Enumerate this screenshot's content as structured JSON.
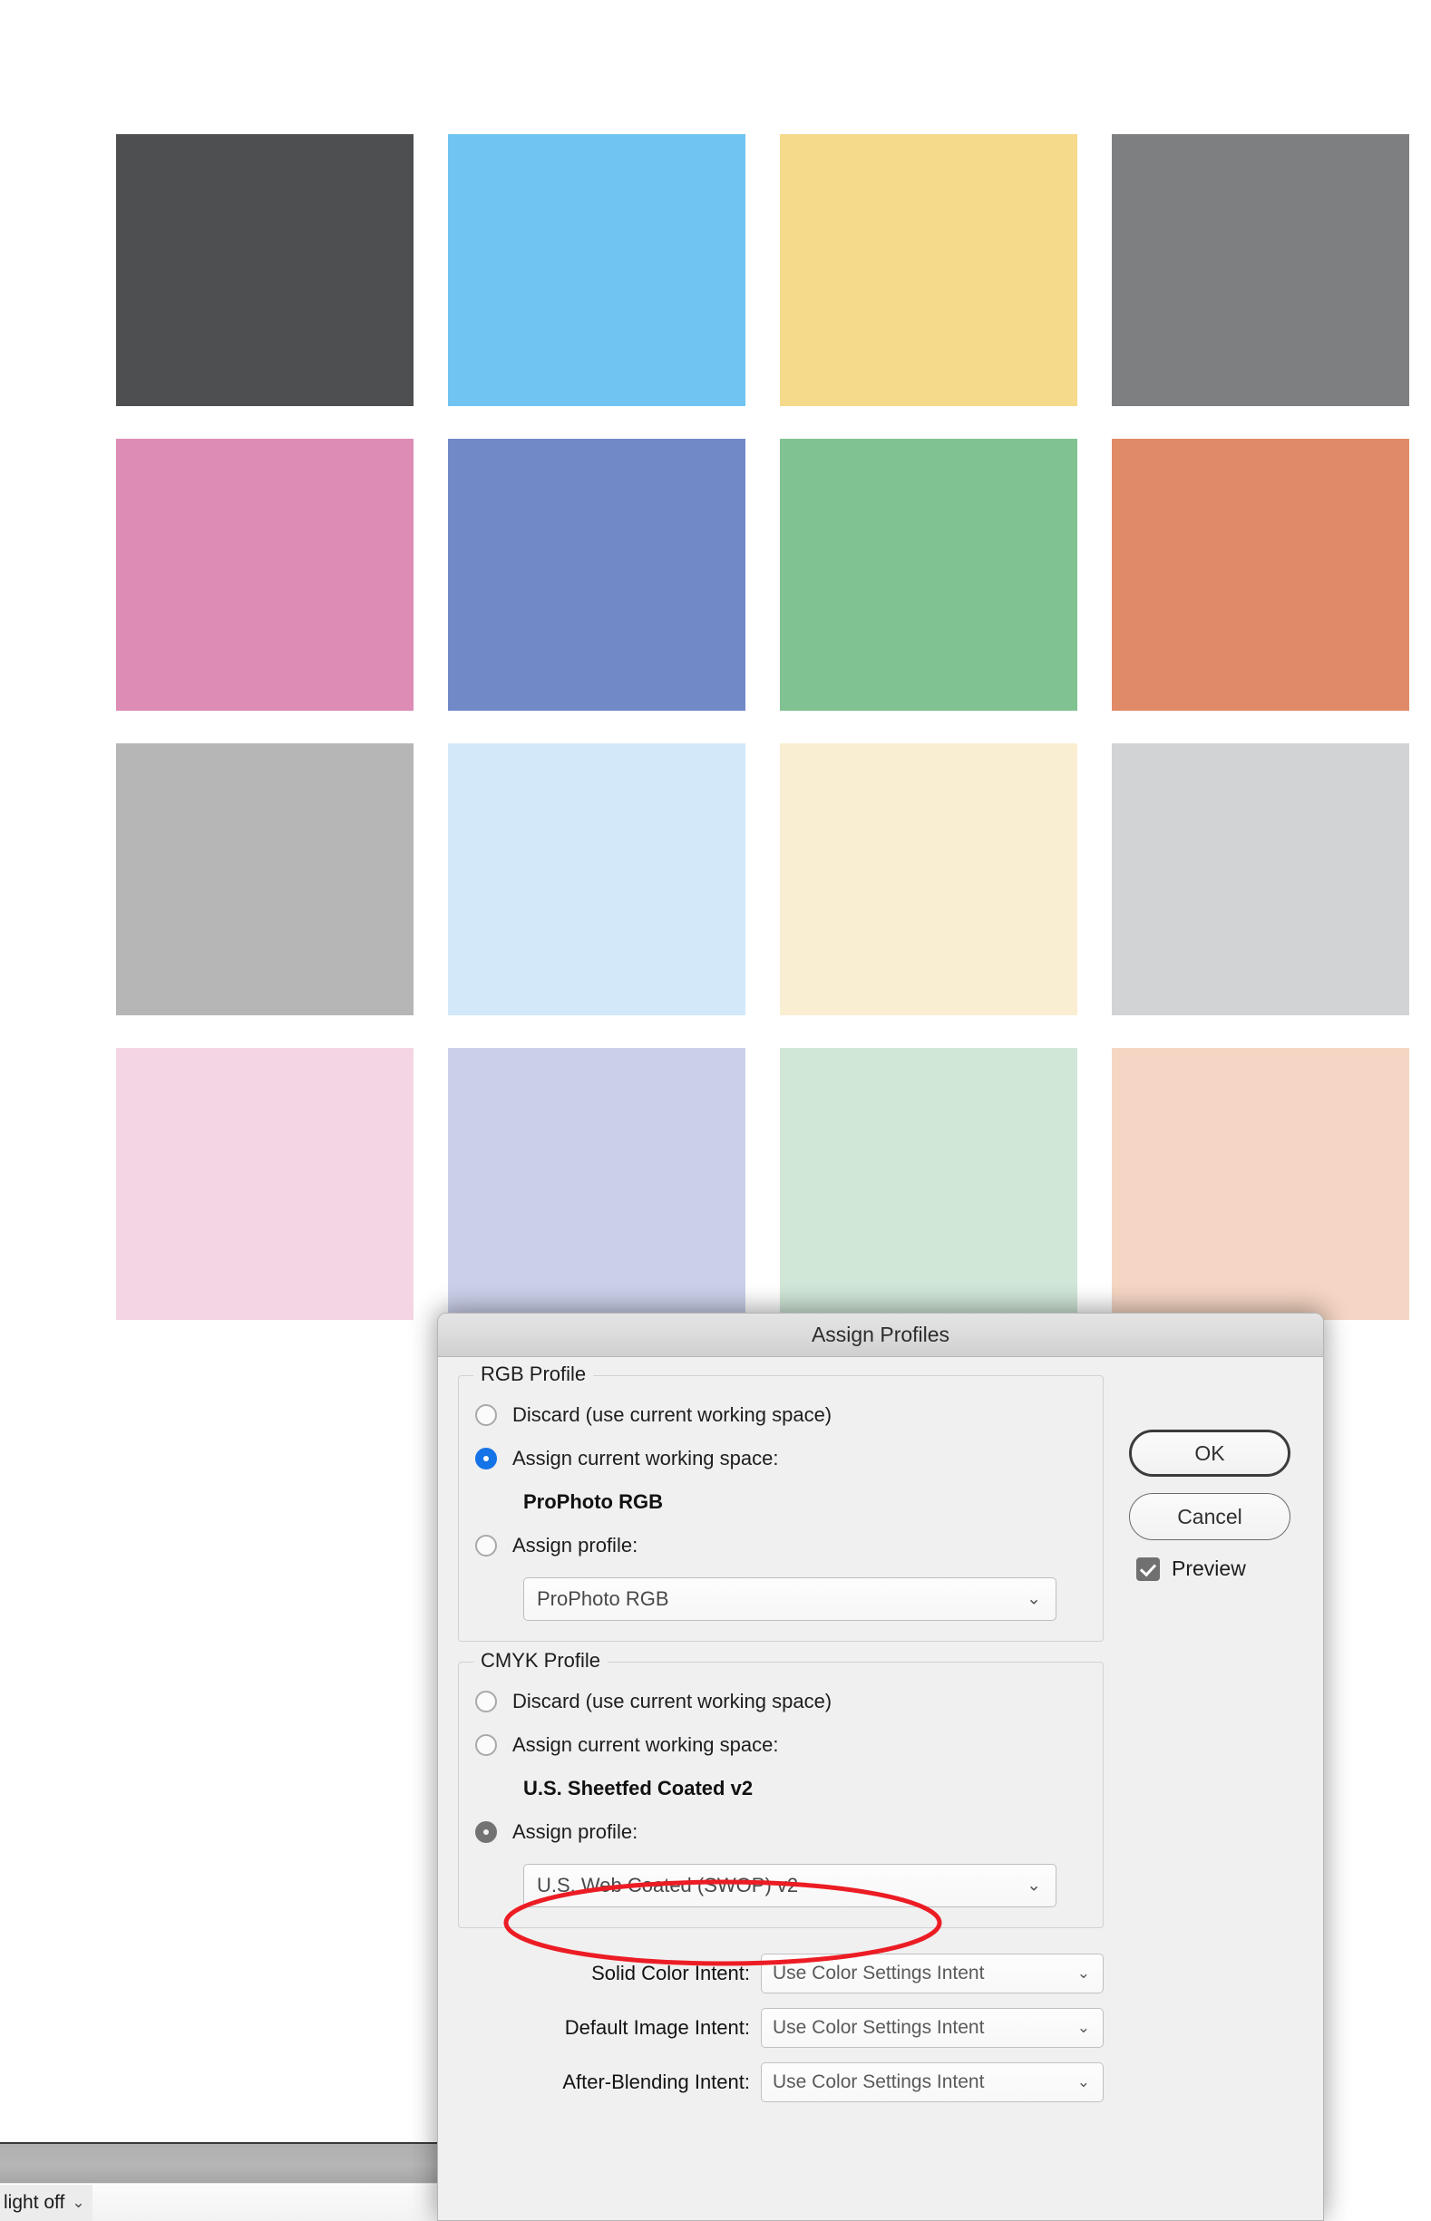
{
  "swatches": {
    "rows": [
      [
        {
          "name": "swatch-dark-gray",
          "color": "#4e4f50"
        },
        {
          "name": "swatch-sky-blue",
          "color": "#6fc4f2"
        },
        {
          "name": "swatch-yellow",
          "color": "#f5da8c"
        },
        {
          "name": "swatch-mid-gray",
          "color": "#7e7f81"
        }
      ],
      [
        {
          "name": "swatch-pink",
          "color": "#dd8cb5"
        },
        {
          "name": "swatch-blue-violet",
          "color": "#7289c8"
        },
        {
          "name": "swatch-green",
          "color": "#80c292"
        },
        {
          "name": "swatch-salmon",
          "color": "#e08a67"
        }
      ],
      [
        {
          "name": "swatch-light-gray",
          "color": "#b6b6b6"
        },
        {
          "name": "swatch-pale-blue",
          "color": "#d3e9f9"
        },
        {
          "name": "swatch-cream",
          "color": "#faeed2"
        },
        {
          "name": "swatch-pale-gray",
          "color": "#d2d3d5"
        }
      ],
      [
        {
          "name": "swatch-pale-pink",
          "color": "#f4d5e4"
        },
        {
          "name": "swatch-lavender",
          "color": "#cbd0ea"
        },
        {
          "name": "swatch-mint",
          "color": "#d0e6d7"
        },
        {
          "name": "swatch-peach",
          "color": "#f5d6c4"
        }
      ]
    ]
  },
  "dialog": {
    "title": "Assign Profiles",
    "rgb_group": {
      "legend": "RGB Profile",
      "options": [
        {
          "label": "Discard (use current working space)",
          "selected": false
        },
        {
          "label": "Assign current working space:",
          "selected": true
        },
        {
          "label": "Assign profile:",
          "selected": false
        }
      ],
      "working_space_value": "ProPhoto RGB",
      "profile_select_value": "ProPhoto RGB"
    },
    "cmyk_group": {
      "legend": "CMYK Profile",
      "options": [
        {
          "label": "Discard (use current working space)",
          "selected": false
        },
        {
          "label": "Assign current working space:",
          "selected": false
        },
        {
          "label": "Assign profile:",
          "selected": true
        }
      ],
      "working_space_value": "U.S. Sheetfed Coated v2",
      "profile_select_value": "U.S. Web Coated (SWOP) v2"
    },
    "intents": [
      {
        "label": "Solid Color Intent:",
        "value": "Use Color Settings Intent"
      },
      {
        "label": "Default Image Intent:",
        "value": "Use Color Settings Intent"
      },
      {
        "label": "After-Blending Intent:",
        "value": "Use Color Settings Intent"
      }
    ],
    "buttons": {
      "ok": "OK",
      "cancel": "Cancel"
    },
    "preview": {
      "label": "Preview",
      "checked": true
    }
  },
  "status_bar": {
    "light_select_value": "light off",
    "chevron": "⌄"
  },
  "annotation": {
    "shape": "ellipse",
    "color": "#ec1c24",
    "targets": "cmyk-assign-profile-select"
  },
  "icons": {
    "chevron_down": "⌄"
  }
}
